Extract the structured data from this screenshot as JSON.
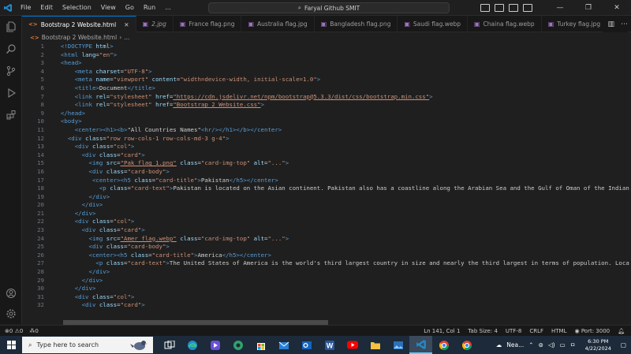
{
  "titlebar": {
    "menu": [
      "File",
      "Edit",
      "Selection",
      "View",
      "Go",
      "Run",
      "..."
    ],
    "command_center": "Faryal Github SMIT"
  },
  "tabs": [
    {
      "label": "Bootstrap 2 Website.html",
      "type": "html",
      "active": true
    },
    {
      "label": "2.jpg",
      "type": "image"
    },
    {
      "label": "France flag.png",
      "type": "image"
    },
    {
      "label": "Australia flag.jpg",
      "type": "image"
    },
    {
      "label": "Bangladesh flag.png",
      "type": "image"
    },
    {
      "label": "Saudi flag.webp",
      "type": "image"
    },
    {
      "label": "Chaina flag.webp",
      "type": "image"
    },
    {
      "label": "Turkey flag.jpg",
      "type": "image"
    }
  ],
  "breadcrumb": {
    "file": "Bootstrap 2 Website.html",
    "sep": "›",
    "more": "..."
  },
  "code_lines": [
    {
      "n": "1",
      "t": [
        [
          "  ",
          "tx"
        ],
        [
          "<!DOCTYPE ",
          "tg"
        ],
        [
          "html",
          "at"
        ],
        [
          ">",
          "tg"
        ]
      ]
    },
    {
      "n": "2",
      "t": [
        [
          "  ",
          "tx"
        ],
        [
          "<html ",
          "tg"
        ],
        [
          "lang",
          "at"
        ],
        [
          "=",
          "tx"
        ],
        [
          "\"en\"",
          "sv"
        ],
        [
          ">",
          "tg"
        ]
      ]
    },
    {
      "n": "3",
      "t": [
        [
          "  ",
          "tx"
        ],
        [
          "<head>",
          "tg"
        ]
      ]
    },
    {
      "n": "4",
      "t": [
        [
          "      ",
          "tx"
        ],
        [
          "<meta ",
          "tg"
        ],
        [
          "charset",
          "at"
        ],
        [
          "=",
          "tx"
        ],
        [
          "\"UTF-8\"",
          "sv"
        ],
        [
          ">",
          "tg"
        ]
      ]
    },
    {
      "n": "5",
      "t": [
        [
          "      ",
          "tx"
        ],
        [
          "<meta ",
          "tg"
        ],
        [
          "name",
          "at"
        ],
        [
          "=",
          "tx"
        ],
        [
          "\"viewport\" ",
          "sv"
        ],
        [
          "content",
          "at"
        ],
        [
          "=",
          "tx"
        ],
        [
          "\"width=device-width, initial-scale=1.0\"",
          "sv"
        ],
        [
          ">",
          "tg"
        ]
      ]
    },
    {
      "n": "6",
      "t": [
        [
          "      ",
          "tx"
        ],
        [
          "<title>",
          "tg"
        ],
        [
          "Document",
          "tx"
        ],
        [
          "</title>",
          "tg"
        ]
      ]
    },
    {
      "n": "7",
      "t": [
        [
          "      ",
          "tx"
        ],
        [
          "<link ",
          "tg"
        ],
        [
          "rel",
          "at"
        ],
        [
          "=",
          "tx"
        ],
        [
          "\"stylesheet\" ",
          "sv"
        ],
        [
          "href",
          "at"
        ],
        [
          "=",
          "tx"
        ],
        [
          "\"https://cdn.jsdelivr.net/npm/bootstrap@5.3.3/dist/css/bootstrap.min.css\"",
          "sv ul"
        ],
        [
          ">",
          "tg"
        ]
      ]
    },
    {
      "n": "8",
      "t": [
        [
          "      ",
          "tx"
        ],
        [
          "<link ",
          "tg"
        ],
        [
          "rel",
          "at"
        ],
        [
          "=",
          "tx"
        ],
        [
          "\"stylesheet\" ",
          "sv"
        ],
        [
          "href",
          "at"
        ],
        [
          "=",
          "tx"
        ],
        [
          "\"Bootstrap 2 Website.css\"",
          "sv ul"
        ],
        [
          ">",
          "tg"
        ]
      ]
    },
    {
      "n": "9",
      "t": [
        [
          "  ",
          "tx"
        ],
        [
          "</head>",
          "tg"
        ]
      ]
    },
    {
      "n": "10",
      "t": [
        [
          "  ",
          "tx"
        ],
        [
          "<body>",
          "tg"
        ]
      ]
    },
    {
      "n": "11",
      "t": [
        [
          "      ",
          "tx"
        ],
        [
          "<center><h1><b>",
          "tg"
        ],
        [
          "\"All Countries Names\"",
          "tx"
        ],
        [
          "<hr/></h1></b></center>",
          "tg"
        ]
      ]
    },
    {
      "n": "12",
      "t": [
        [
          "    ",
          "tx"
        ],
        [
          "<div ",
          "tg"
        ],
        [
          "class",
          "at"
        ],
        [
          "=",
          "tx"
        ],
        [
          "\"row row-cols-1 row-cols-md-3 g-4\"",
          "sv"
        ],
        [
          ">",
          "tg"
        ]
      ]
    },
    {
      "n": "13",
      "t": [
        [
          "      ",
          "tx"
        ],
        [
          "<div ",
          "tg"
        ],
        [
          "class",
          "at"
        ],
        [
          "=",
          "tx"
        ],
        [
          "\"col\"",
          "sv"
        ],
        [
          ">",
          "tg"
        ]
      ]
    },
    {
      "n": "14",
      "t": [
        [
          "        ",
          "tx"
        ],
        [
          "<div ",
          "tg"
        ],
        [
          "class",
          "at"
        ],
        [
          "=",
          "tx"
        ],
        [
          "\"card\"",
          "sv"
        ],
        [
          ">",
          "tg"
        ]
      ]
    },
    {
      "n": "15",
      "t": [
        [
          "          ",
          "tx"
        ],
        [
          "<img ",
          "tg"
        ],
        [
          "src",
          "at"
        ],
        [
          "=",
          "tx"
        ],
        [
          "\"Pak flag 1.png\"",
          "sv ul"
        ],
        [
          " ",
          "tx"
        ],
        [
          "class",
          "at"
        ],
        [
          "=",
          "tx"
        ],
        [
          "\"card-img-top\" ",
          "sv"
        ],
        [
          "alt",
          "at"
        ],
        [
          "=",
          "tx"
        ],
        [
          "\"...\"",
          "sv"
        ],
        [
          ">",
          "tg"
        ]
      ]
    },
    {
      "n": "16",
      "t": [
        [
          "          ",
          "tx"
        ],
        [
          "<div ",
          "tg"
        ],
        [
          "class",
          "at"
        ],
        [
          "=",
          "tx"
        ],
        [
          "\"card-body\"",
          "sv"
        ],
        [
          ">",
          "tg"
        ]
      ]
    },
    {
      "n": "17",
      "t": [
        [
          "           ",
          "tx"
        ],
        [
          "<center><h5 ",
          "tg"
        ],
        [
          "class",
          "at"
        ],
        [
          "=",
          "tx"
        ],
        [
          "\"card-title\"",
          "sv"
        ],
        [
          ">",
          "tg"
        ],
        [
          "Pakistan",
          "tx"
        ],
        [
          "</h5></center>",
          "tg"
        ]
      ]
    },
    {
      "n": "18",
      "t": [
        [
          "             ",
          "tx"
        ],
        [
          "<p ",
          "tg"
        ],
        [
          "class",
          "at"
        ],
        [
          "=",
          "tx"
        ],
        [
          "\"card-text\"",
          "sv"
        ],
        [
          ">",
          "tg"
        ],
        [
          "Pakistan is located on the Asian continent. Pakistan also has a coastline along the Arabian Sea and the Gulf of Oman of the Indian O",
          "tx"
        ]
      ]
    },
    {
      "n": "19",
      "t": [
        [
          "          ",
          "tx"
        ],
        [
          "</div>",
          "tg"
        ]
      ]
    },
    {
      "n": "20",
      "t": [
        [
          "        ",
          "tx"
        ],
        [
          "</div>",
          "tg"
        ]
      ]
    },
    {
      "n": "21",
      "t": [
        [
          "      ",
          "tx"
        ],
        [
          "</div>",
          "tg"
        ]
      ]
    },
    {
      "n": "22",
      "t": [
        [
          "      ",
          "tx"
        ],
        [
          "<div ",
          "tg"
        ],
        [
          "class",
          "at"
        ],
        [
          "=",
          "tx"
        ],
        [
          "\"col\"",
          "sv"
        ],
        [
          ">",
          "tg"
        ]
      ]
    },
    {
      "n": "23",
      "t": [
        [
          "        ",
          "tx"
        ],
        [
          "<div ",
          "tg"
        ],
        [
          "class",
          "at"
        ],
        [
          "=",
          "tx"
        ],
        [
          "\"card\"",
          "sv"
        ],
        [
          ">",
          "tg"
        ]
      ]
    },
    {
      "n": "24",
      "t": [
        [
          "          ",
          "tx"
        ],
        [
          "<img ",
          "tg"
        ],
        [
          "src",
          "at"
        ],
        [
          "=",
          "tx"
        ],
        [
          "\"Amer flag.webp\"",
          "sv ul"
        ],
        [
          " ",
          "tx"
        ],
        [
          "class",
          "at"
        ],
        [
          "=",
          "tx"
        ],
        [
          "\"card-img-top\" ",
          "sv"
        ],
        [
          "alt",
          "at"
        ],
        [
          "=",
          "tx"
        ],
        [
          "\"...\"",
          "sv"
        ],
        [
          ">",
          "tg"
        ]
      ]
    },
    {
      "n": "25",
      "t": [
        [
          "          ",
          "tx"
        ],
        [
          "<div ",
          "tg"
        ],
        [
          "class",
          "at"
        ],
        [
          "=",
          "tx"
        ],
        [
          "\"card-body\"",
          "sv"
        ],
        [
          ">",
          "tg"
        ]
      ]
    },
    {
      "n": "26",
      "t": [
        [
          "          ",
          "tx"
        ],
        [
          "<center><h5 ",
          "tg"
        ],
        [
          "class",
          "at"
        ],
        [
          "=",
          "tx"
        ],
        [
          "\"card-title\"",
          "sv"
        ],
        [
          ">",
          "tg"
        ],
        [
          "America",
          "tx"
        ],
        [
          "</h5></center>",
          "tg"
        ]
      ]
    },
    {
      "n": "27",
      "t": [
        [
          "            ",
          "tx"
        ],
        [
          "<p ",
          "tg"
        ],
        [
          "class",
          "at"
        ],
        [
          "=",
          "tx"
        ],
        [
          "\"card-text\"",
          "sv"
        ],
        [
          ">",
          "tg"
        ],
        [
          "The United States of America is the world's third largest country in size and nearly the third largest in terms of population. Loca",
          "tx"
        ]
      ]
    },
    {
      "n": "28",
      "t": [
        [
          "          ",
          "tx"
        ],
        [
          "</div>",
          "tg"
        ]
      ]
    },
    {
      "n": "29",
      "t": [
        [
          "        ",
          "tx"
        ],
        [
          "</div>",
          "tg"
        ]
      ]
    },
    {
      "n": "30",
      "t": [
        [
          "      ",
          "tx"
        ],
        [
          "</div>",
          "tg"
        ]
      ]
    },
    {
      "n": "31",
      "t": [
        [
          "      ",
          "tx"
        ],
        [
          "<div ",
          "tg"
        ],
        [
          "class",
          "at"
        ],
        [
          "=",
          "tx"
        ],
        [
          "\"col\"",
          "sv"
        ],
        [
          ">",
          "tg"
        ]
      ]
    },
    {
      "n": "32",
      "t": [
        [
          "        ",
          "tx"
        ],
        [
          "<div ",
          "tg"
        ],
        [
          "class",
          "at"
        ],
        [
          "=",
          "tx"
        ],
        [
          "\"card\"",
          "sv"
        ],
        [
          ">",
          "tg"
        ]
      ]
    }
  ],
  "statusbar": {
    "errors": "0",
    "warnings": "0",
    "ports": "0",
    "position": "Ln 141, Col 1",
    "tab_size": "Tab Size: 4",
    "encoding": "UTF-8",
    "eol": "CRLF",
    "language": "HTML",
    "live_server": "Port: 3000"
  },
  "taskbar": {
    "search_placeholder": "Type here to search",
    "weather": "Nea...",
    "time": "6:30 PM",
    "date": "4/22/2024"
  },
  "colors": {
    "accent": "#0078d4",
    "tag": "#569cd6",
    "attr": "#9cdcfe",
    "string": "#ce9178"
  }
}
